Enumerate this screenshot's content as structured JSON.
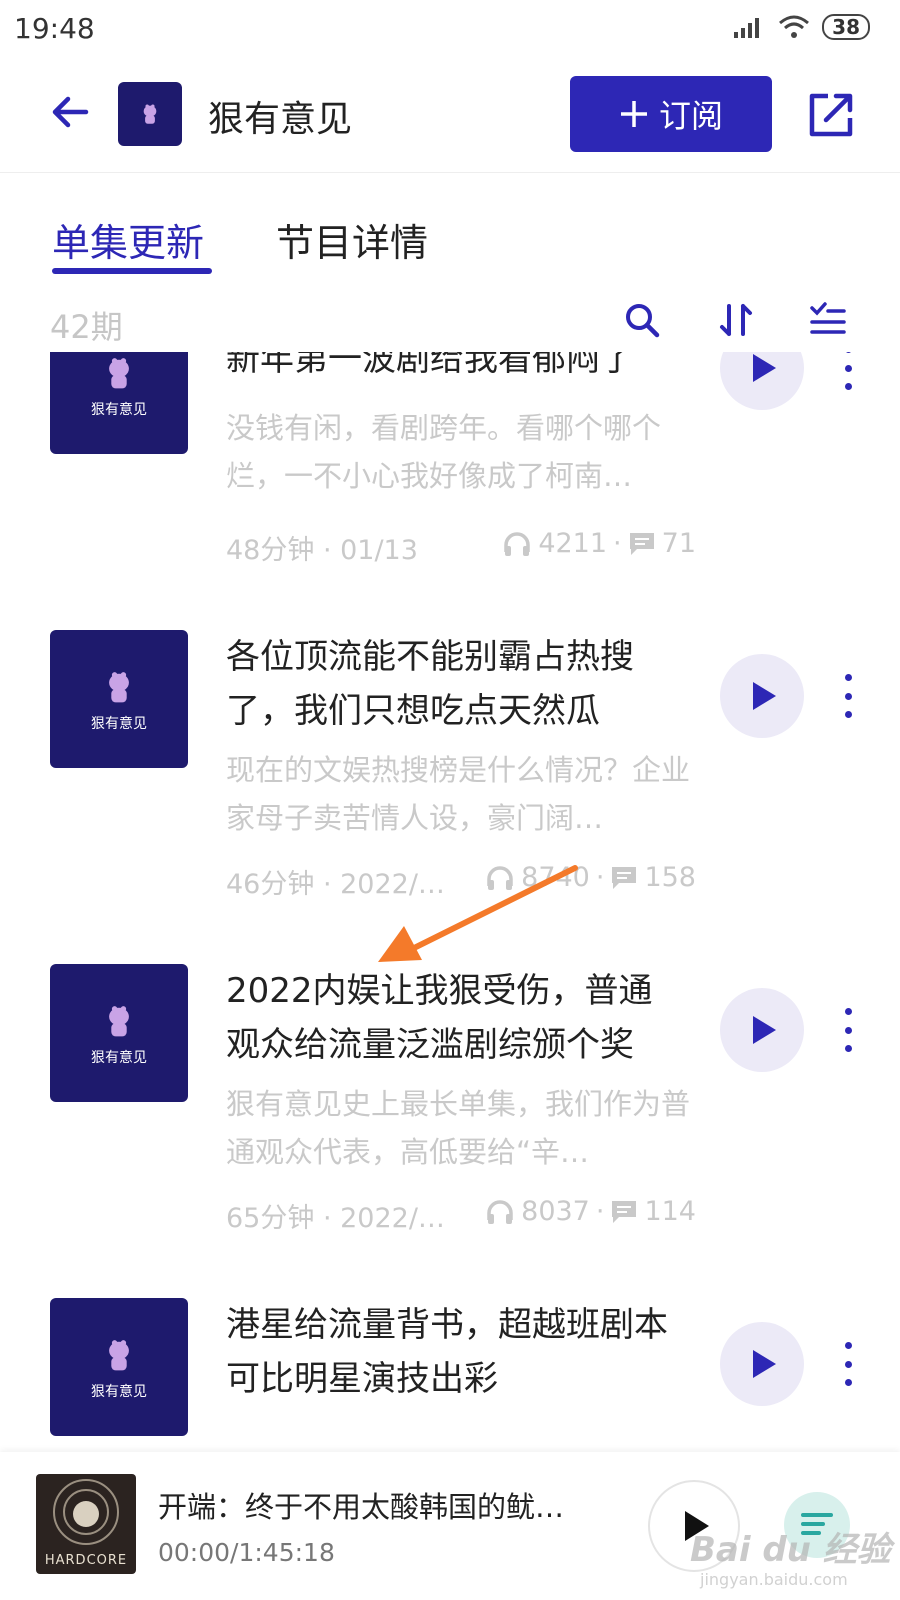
{
  "status_bar": {
    "time": "19:48",
    "battery": "38"
  },
  "header": {
    "title": "狠有意见",
    "subscribe_label": "订阅"
  },
  "tabs": [
    {
      "label": "单集更新"
    },
    {
      "label": "节目详情"
    }
  ],
  "toolbar": {
    "episode_count": "42期"
  },
  "episodes": [
    {
      "title": "新年第一波剧给我看郁闷了",
      "description": "没钱有闲，看剧跨年。看哪个哪个烂，一不小心我好像成了柯南…",
      "duration_date": "48分钟 · 01/13",
      "plays": "4211",
      "comments": "71"
    },
    {
      "title": "各位顶流能不能别霸占热搜了，我们只想吃点天然瓜",
      "description": "现在的文娱热搜榜是什么情况？企业家母子卖苦情人设，豪门阔…",
      "duration_date": "46分钟 · 2022/…",
      "plays": "8740",
      "comments": "158"
    },
    {
      "title": "2022内娱让我狠受伤，普通观众给流量泛滥剧综颁个奖",
      "description": "狠有意见史上最长单集，我们作为普通观众代表，高低要给“辛…",
      "duration_date": "65分钟 · 2022/…",
      "plays": "8037",
      "comments": "114"
    },
    {
      "title": "港星给流量背书，超越班剧本可比明星演技出彩",
      "description": "",
      "duration_date": "",
      "plays": "",
      "comments": ""
    }
  ],
  "thumb": {
    "name": "狠有意见"
  },
  "player": {
    "title": "开端：终于不用太酸韩国的鱿…",
    "time": "00:00/1:45:18",
    "cover_text": "HARDCORE"
  },
  "watermark": {
    "main": "Bai du 经验",
    "sub": "jingyan.baidu.com"
  },
  "colors": {
    "accent": "#2d27b5",
    "thumb_bg": "#1e1a6d",
    "annotation_arrow": "#f47a2a"
  }
}
